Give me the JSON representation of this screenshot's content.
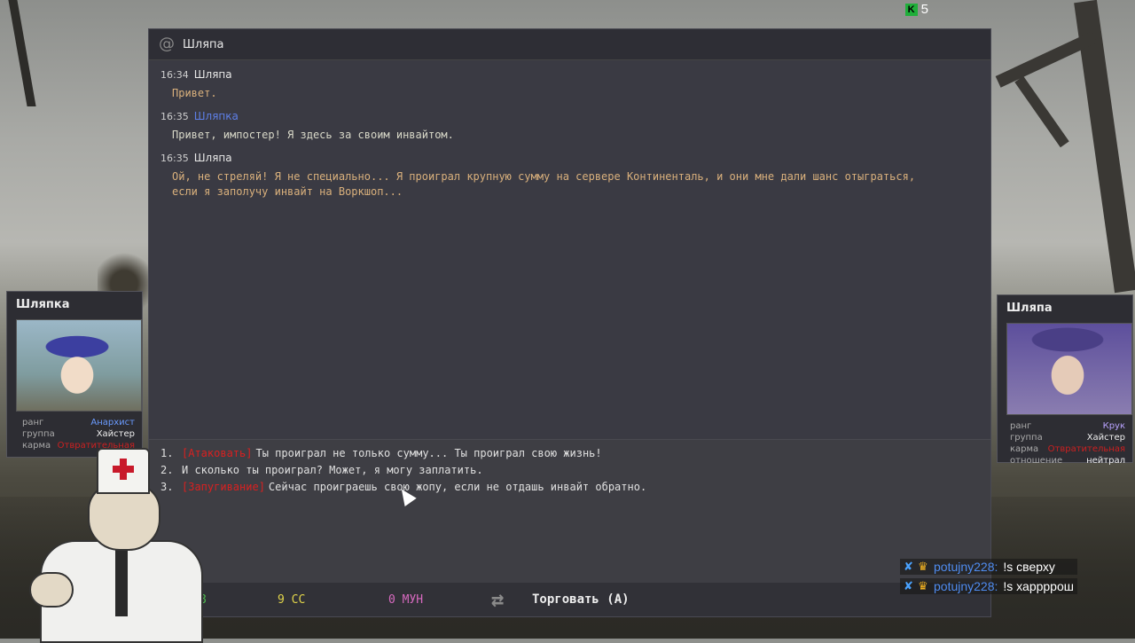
{
  "hud": {
    "kill_count": "5",
    "kill_icon_letter": "K"
  },
  "dialog": {
    "title": "Шляпа",
    "messages": [
      {
        "time": "16:34",
        "speaker": "Шляпа",
        "text": "Привет."
      },
      {
        "time": "16:35",
        "speaker": "Шляпка",
        "text": "Привет, импостер! Я здесь за своим инвайтом."
      },
      {
        "time": "16:35",
        "speaker": "Шляпа",
        "text": "Ой, не стреляй! Я не специально... Я проиграл крупную сумму на сервере Континенталь, и они мне дали шанс отыграться, если я заполучу инвайт на Воркшоп..."
      }
    ],
    "choices": [
      {
        "num": "1.",
        "tag": "[Атаковать]",
        "text": "Ты проиграл не только сумму... Ты проиграл свою жизнь!"
      },
      {
        "num": "2.",
        "tag": "",
        "text": "И сколько ты проиграл? Может, я могу заплатить."
      },
      {
        "num": "3.",
        "tag": "[Запугивание]",
        "text": "Сейчас проиграешь свою жопу, если не отдашь инвайт обратно."
      }
    ],
    "bottom": {
      "stat1": "8",
      "stat2": "9 СС",
      "stat3": "0 МУН",
      "trade_label": "Торговать (А)"
    }
  },
  "left_card": {
    "name": "Шляпка",
    "stats": [
      {
        "key": "ранг",
        "value": "Анархист"
      },
      {
        "key": "группа",
        "value": "Хайстер"
      },
      {
        "key": "карма",
        "value": "Отвратительная"
      }
    ]
  },
  "right_card": {
    "name": "Шляпа",
    "stats": [
      {
        "key": "ранг",
        "value": "Крук"
      },
      {
        "key": "группа",
        "value": "Хайстер"
      },
      {
        "key": "карма",
        "value": "Отвратительная"
      },
      {
        "key": "отношение",
        "value": "нейтрал"
      }
    ]
  },
  "chat": [
    {
      "user": "potujny228:",
      "text": "!s сверху"
    },
    {
      "user": "potujny228:",
      "text": "!s харрррош"
    }
  ],
  "colors": {
    "dialog_bg": "#3a3a43",
    "accent_blue": "#5e7fe6",
    "attack_red": "#d92020"
  }
}
